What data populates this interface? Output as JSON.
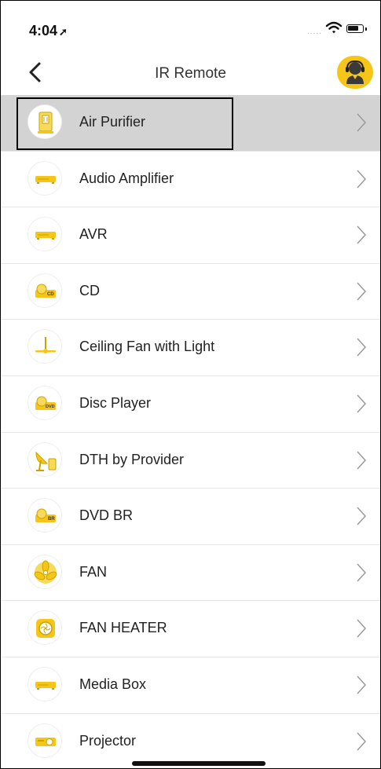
{
  "status_bar": {
    "time": "4:04",
    "signal": "....."
  },
  "header": {
    "title": "IR Remote"
  },
  "colors": {
    "accent": "#F5C518",
    "selected_row": "#D3D3D3",
    "divider": "#E6E6E6"
  },
  "devices": [
    {
      "label": "Air Purifier",
      "icon": "air-purifier-icon",
      "selected": true
    },
    {
      "label": "Audio Amplifier",
      "icon": "amplifier-icon"
    },
    {
      "label": "AVR",
      "icon": "avr-icon"
    },
    {
      "label": "CD",
      "icon": "cd-player-icon",
      "icon_text": "CD"
    },
    {
      "label": "Ceiling Fan with Light",
      "icon": "ceiling-fan-icon"
    },
    {
      "label": "Disc Player",
      "icon": "disc-player-icon",
      "icon_text": "DVD"
    },
    {
      "label": "DTH by Provider",
      "icon": "satellite-dish-icon"
    },
    {
      "label": "DVD BR",
      "icon": "dvd-br-icon",
      "icon_text": "BR"
    },
    {
      "label": "FAN",
      "icon": "fan-icon"
    },
    {
      "label": "FAN HEATER",
      "icon": "fan-heater-icon"
    },
    {
      "label": "Media Box",
      "icon": "media-box-icon"
    },
    {
      "label": "Projector",
      "icon": "projector-icon"
    }
  ]
}
